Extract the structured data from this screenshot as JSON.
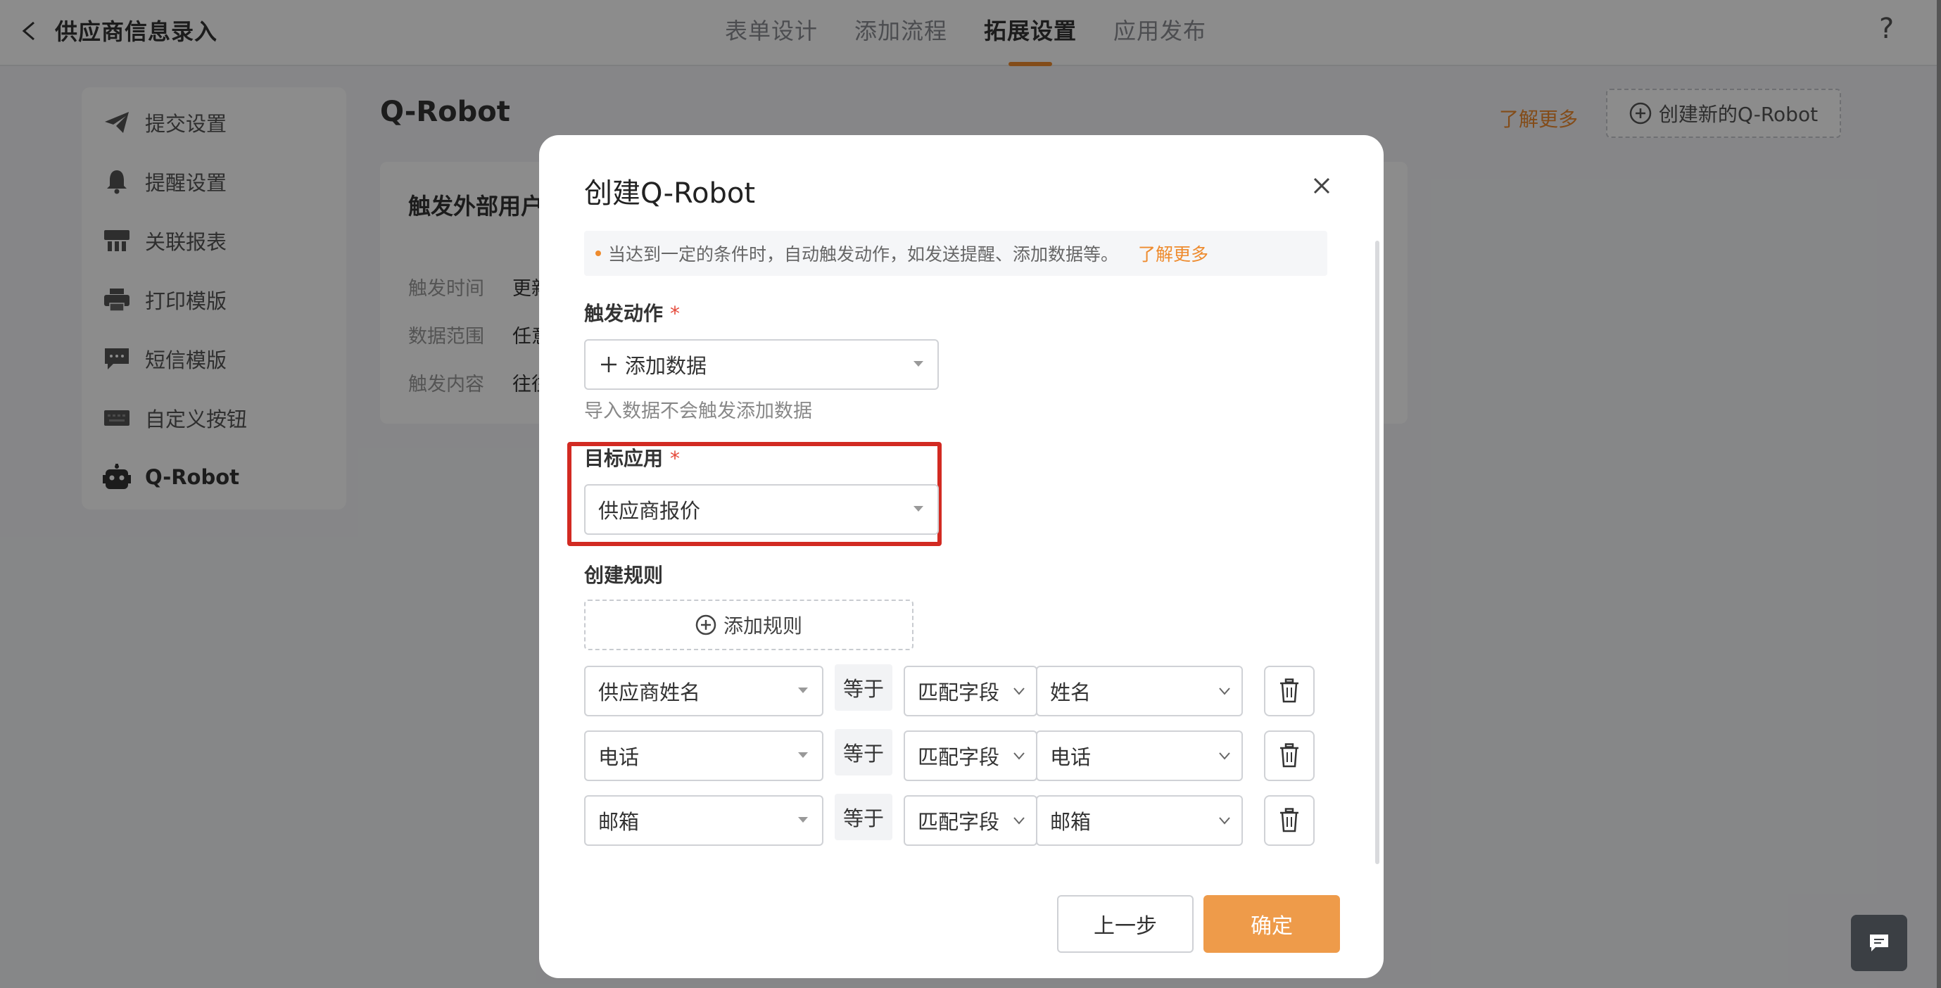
{
  "header": {
    "app_title": "供应商信息录入",
    "tabs": [
      "表单设计",
      "添加流程",
      "拓展设置",
      "应用发布"
    ],
    "active_tab": "拓展设置",
    "help": "?"
  },
  "sidebar": {
    "items": [
      {
        "label": "提交设置",
        "icon": "paper-plane-icon"
      },
      {
        "label": "提醒设置",
        "icon": "bell-icon"
      },
      {
        "label": "关联报表",
        "icon": "report-icon"
      },
      {
        "label": "打印模版",
        "icon": "printer-icon"
      },
      {
        "label": "短信模版",
        "icon": "message-icon"
      },
      {
        "label": "自定义按钮",
        "icon": "keyboard-icon"
      },
      {
        "label": "Q-Robot",
        "icon": "robot-icon",
        "active": true
      }
    ]
  },
  "main": {
    "title": "Q-Robot",
    "learn_more": "了解更多",
    "create_button": "创建新的Q-Robot",
    "card": {
      "title": "触发外部用户",
      "rows": [
        {
          "key": "触发时间",
          "value": "更新"
        },
        {
          "key": "数据范围",
          "value": "任意"
        },
        {
          "key": "触发内容",
          "value": "往往"
        }
      ]
    }
  },
  "modal": {
    "title": "创建Q-Robot",
    "notice": "当达到一定的条件时，自动触发动作，如发送提醒、添加数据等。",
    "notice_link": "了解更多",
    "trigger_action_label": "触发动作",
    "required_mark": "*",
    "trigger_action_value": "添加数据",
    "trigger_hint": "导入数据不会触发添加数据",
    "target_app_label": "目标应用",
    "target_app_value": "供应商报价",
    "rules_label": "创建规则",
    "add_rule_button": "添加规则",
    "rules": [
      {
        "field": "供应商姓名",
        "operator": "等于",
        "match_type": "匹配字段",
        "target": "姓名"
      },
      {
        "field": "电话",
        "operator": "等于",
        "match_type": "匹配字段",
        "target": "电话"
      },
      {
        "field": "邮箱",
        "operator": "等于",
        "match_type": "匹配字段",
        "target": "邮箱"
      }
    ],
    "prev_button": "上一步",
    "confirm_button": "确定"
  },
  "colors": {
    "accent": "#ee8b2e",
    "confirm": "#ee9b4a",
    "highlight": "#d22a22",
    "required": "#e5493a"
  }
}
